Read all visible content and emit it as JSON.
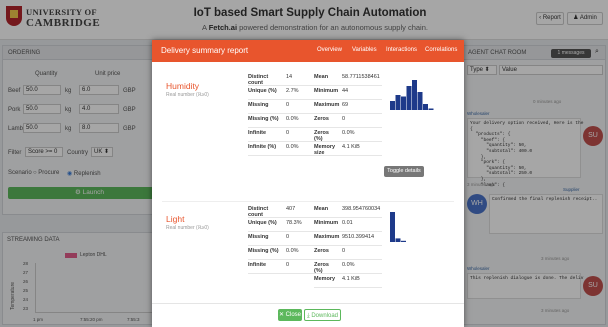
{
  "header": {
    "uni_line1": "UNIVERSITY OF",
    "uni_line2": "CAMBRIDGE",
    "title": "IoT based Smart Supply Chain Automation",
    "subtitle_prefix": "A ",
    "subtitle_brand": "Fetch.ai",
    "subtitle_suffix": " powered demonstration for an autonomous supply chain.",
    "report_button": "Report",
    "admin_button": "Admin"
  },
  "ordering": {
    "title": "ORDERING",
    "col_quantity": "Quantity",
    "col_unit_price": "Unit price",
    "rows": [
      {
        "name": "Beef",
        "qty": "50.0",
        "unit": "kg",
        "price": "6.0",
        "cur": "GBP"
      },
      {
        "name": "Pork",
        "qty": "50.0",
        "unit": "kg",
        "price": "4.0",
        "cur": "GBP"
      },
      {
        "name": "Lamb",
        "qty": "50.0",
        "unit": "kg",
        "price": "8.0",
        "cur": "GBP"
      }
    ],
    "filter_label": "Filter",
    "filter_value": "Score >= 0",
    "country_label": "Country",
    "country_value": "UK",
    "scenario_label": "Scenario",
    "opt_procure": "Procure",
    "opt_replenish": "Replenish",
    "launch": "Launch"
  },
  "streaming": {
    "title": "STREAMING DATA",
    "legend": "Lepton DHL",
    "ylabel": "Temperature",
    "yticks": [
      "28",
      "27",
      "26",
      "25",
      "24",
      "23"
    ],
    "xticks": [
      "1 pm",
      "7:55:20 pm",
      "7:55:3",
      "1 pm",
      "7:55:20 pm",
      "7:55:3",
      "1 pm",
      "7:55:20 pm",
      "7:55:3"
    ]
  },
  "agent_chat": {
    "title": "AGENT CHAT ROOM",
    "messages_badge": "messages",
    "type_label": "Type",
    "value_label": "Value",
    "ago1": "0 minutes ago",
    "sender1": "Wholesaler",
    "msg1": "Your delivery option received, Here is the\n{\n  \"products\": {\n    \"beef\": {\n      \"quantity\": 50,\n      \"subtotal\": 400.0\n    },\n    \"pork\": {\n      \"quantity\": 50,\n      \"subtotal\": 250.0\n    },\n    \"lamb\": {",
    "avatar1": "SU",
    "ago2": "3 minutes ago",
    "sender2": "Supplier",
    "msg2": "Confirmed the final replenish receipt..",
    "avatar2": "WH",
    "ago3": "3 minutes ago",
    "sender3": "Wholesaler",
    "msg3": "This replenish dialogue is done. The deliv",
    "avatar3": "SU",
    "ago4": "3 minutes ago"
  },
  "modal": {
    "title": "Delivery summary report",
    "nav": [
      "Overview",
      "Variables",
      "Interactions",
      "Correlations"
    ],
    "toggle_label": "Toggle details",
    "close": "Close",
    "download": "Download",
    "variables": [
      {
        "name": "Humidity",
        "type": "Real number (ℝ≥0)",
        "left_stats": [
          [
            "Distinct count",
            "14"
          ],
          [
            "Unique (%)",
            "2.7%"
          ],
          [
            "Missing",
            "0"
          ],
          [
            "Missing (%)",
            "0.0%"
          ],
          [
            "Infinite",
            "0"
          ],
          [
            "Infinite (%)",
            "0.0%"
          ]
        ],
        "right_stats": [
          [
            "Mean",
            "58.7711538461"
          ],
          [
            "Minimum",
            "44"
          ],
          [
            "Maximum",
            "69"
          ],
          [
            "Zeros",
            "0"
          ],
          [
            "Zeros (%)",
            "0.0%"
          ],
          [
            "Memory size",
            "4.1 KiB"
          ]
        ],
        "hist": [
          0.3,
          0.5,
          0.45,
          0.8,
          1.0,
          0.6,
          0.2,
          0.05
        ]
      },
      {
        "name": "Light",
        "type": "Real number (ℝ≥0)",
        "left_stats": [
          [
            "Distinct count",
            "407"
          ],
          [
            "Unique (%)",
            "78.3%"
          ],
          [
            "Missing",
            "0"
          ],
          [
            "Missing (%)",
            "0.0%"
          ],
          [
            "Infinite",
            "0"
          ]
        ],
        "right_stats": [
          [
            "Mean",
            "398.954760034"
          ],
          [
            "Minimum",
            "0.01"
          ],
          [
            "Maximum",
            "9510.399414"
          ],
          [
            "Zeros",
            "0"
          ],
          [
            "Zeros (%)",
            "0.0%"
          ],
          [
            "Memory",
            "4.1 KiB"
          ]
        ],
        "hist": [
          1.0,
          0.12,
          0.04
        ]
      }
    ]
  },
  "colors": {
    "accent": "#e8552d",
    "launch": "#5cb85c",
    "close": "#5cb85c",
    "admin_badge": "#3b7dd8"
  }
}
